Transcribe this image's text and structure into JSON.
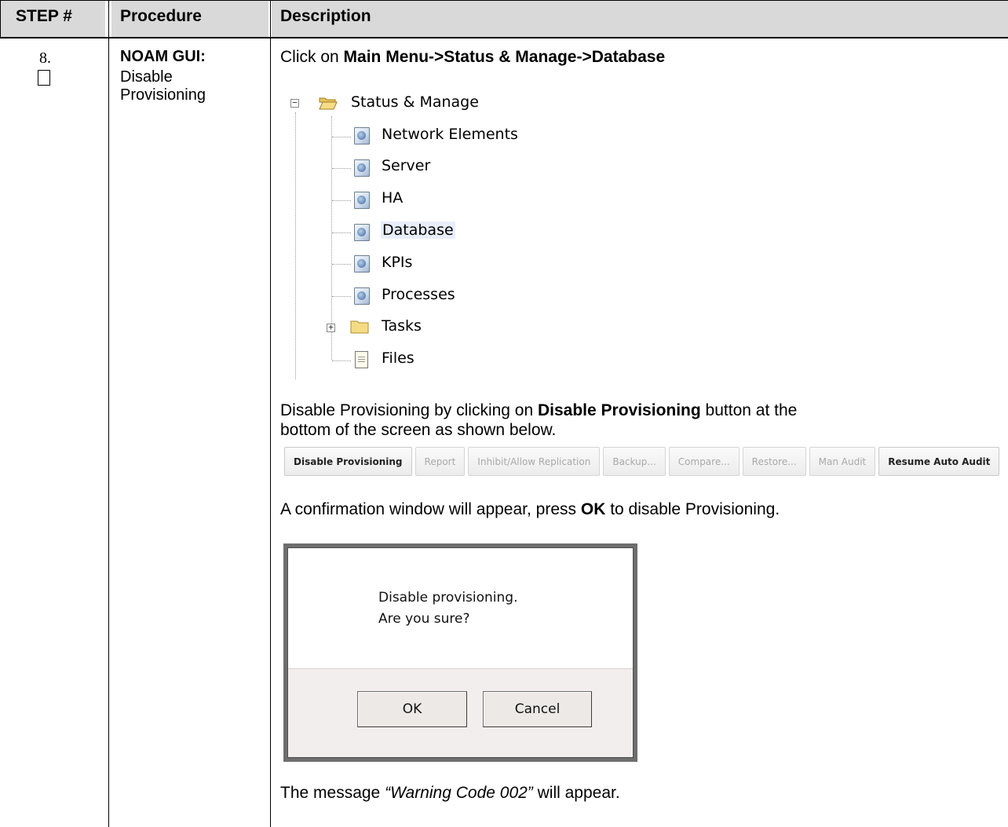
{
  "table": {
    "headers": {
      "step": "STEP #",
      "procedure": "Procedure",
      "description": "Description"
    }
  },
  "row": {
    "step_number": "8.",
    "procedure_title": "NOAM GUI:",
    "procedure_line1": "Disable",
    "procedure_line2": "Provisioning"
  },
  "instructions": {
    "line1_prefix": "Click on ",
    "line1_bold": "Main Menu->Status & Manage->Database",
    "line2_prefix": "Disable Provisioning by clicking on ",
    "line2_bold": "Disable Provisioning",
    "line2_suffix": " button at the",
    "line3": "bottom of the screen as shown below.",
    "line4_prefix": "A confirmation window will appear, press ",
    "line4_bold": "OK",
    "line4_suffix": " to disable Provisioning.",
    "line5_prefix": "The message ",
    "line5_italic": "“Warning Code 002”",
    "line5_suffix": " will appear."
  },
  "tree": {
    "root": {
      "label": "Status & Manage",
      "expander": "−",
      "icon": "open-folder-icon"
    },
    "items": [
      {
        "label": "Network Elements",
        "icon": "page-icon"
      },
      {
        "label": "Server",
        "icon": "page-icon"
      },
      {
        "label": "HA",
        "icon": "page-icon"
      },
      {
        "label": "Database",
        "icon": "page-icon",
        "selected": true
      },
      {
        "label": "KPIs",
        "icon": "page-icon"
      },
      {
        "label": "Processes",
        "icon": "page-icon"
      },
      {
        "label": "Tasks",
        "icon": "folder-icon",
        "expander": "+"
      },
      {
        "label": "Files",
        "icon": "file-icon"
      }
    ]
  },
  "buttons": [
    {
      "label": "Disable Provisioning",
      "enabled": true
    },
    {
      "label": "Report",
      "enabled": false
    },
    {
      "label": "Inhibit/Allow Replication",
      "enabled": false
    },
    {
      "label": "Backup...",
      "enabled": false
    },
    {
      "label": "Compare...",
      "enabled": false
    },
    {
      "label": "Restore...",
      "enabled": false
    },
    {
      "label": "Man Audit",
      "enabled": false
    },
    {
      "label": "Resume Auto Audit",
      "enabled": true
    }
  ],
  "dialog": {
    "message_line1": "Disable provisioning.",
    "message_line2": "Are you sure?",
    "ok_label": "OK",
    "cancel_label": "Cancel"
  },
  "colors": {
    "header_bg": "#d9d9d9",
    "selected_bg": "#e8eefa",
    "dialog_bg": "#f3eeee"
  }
}
